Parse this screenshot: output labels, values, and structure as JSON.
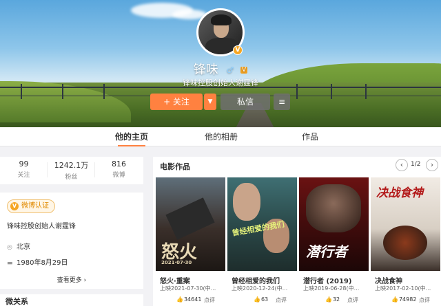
{
  "profile": {
    "name": "锋味",
    "gender_icon": "♂",
    "level_badge": "V",
    "bio": "锋味控股创始人谢霆锋",
    "verified_badge": "V"
  },
  "actions": {
    "follow": "+ 关注",
    "follow_dropdown": "▼",
    "message": "私信",
    "more": "≡"
  },
  "nav": {
    "tabs": [
      {
        "label": "他的主页",
        "active": true
      },
      {
        "label": "他的相册",
        "active": false
      },
      {
        "label": "作品",
        "active": false
      }
    ]
  },
  "stats": [
    {
      "value": "99",
      "label": "关注"
    },
    {
      "value": "1242.1万",
      "label": "粉丝"
    },
    {
      "value": "816",
      "label": "微博"
    }
  ],
  "info": {
    "verified_tag": "微博认证",
    "description": "锋味控股创始人谢霆锋",
    "location": "北京",
    "birthday": "1980年8月29日",
    "more": "查看更多 ›",
    "icons": {
      "location": "location-pin-icon",
      "birthday": "cake-icon"
    }
  },
  "sidebar_next_section": "微关系",
  "works": {
    "title": "电影作品",
    "page": "1/2",
    "prev": "‹",
    "next": "›",
    "movies": [
      {
        "title": "怒火·重案",
        "date": "上映2021-07-30(中...",
        "likes": "34641",
        "comment": "点评",
        "poster_text": "怒火",
        "poster_date": "2021·07·30"
      },
      {
        "title": "曾经相爱的我们",
        "date": "上映2020-12-24(中...",
        "likes": "63",
        "comment": "点评",
        "poster_text": "曾经相爱的我们"
      },
      {
        "title": "潜行者 (2019)",
        "date": "上映2019-06-28(中...",
        "likes": "32",
        "comment": "点评",
        "poster_text": "潜行者"
      },
      {
        "title": "决战食神",
        "date": "上映2017-02-10(中...",
        "likes": "74982",
        "comment": "点评",
        "poster_text": "决战食神"
      }
    ]
  }
}
